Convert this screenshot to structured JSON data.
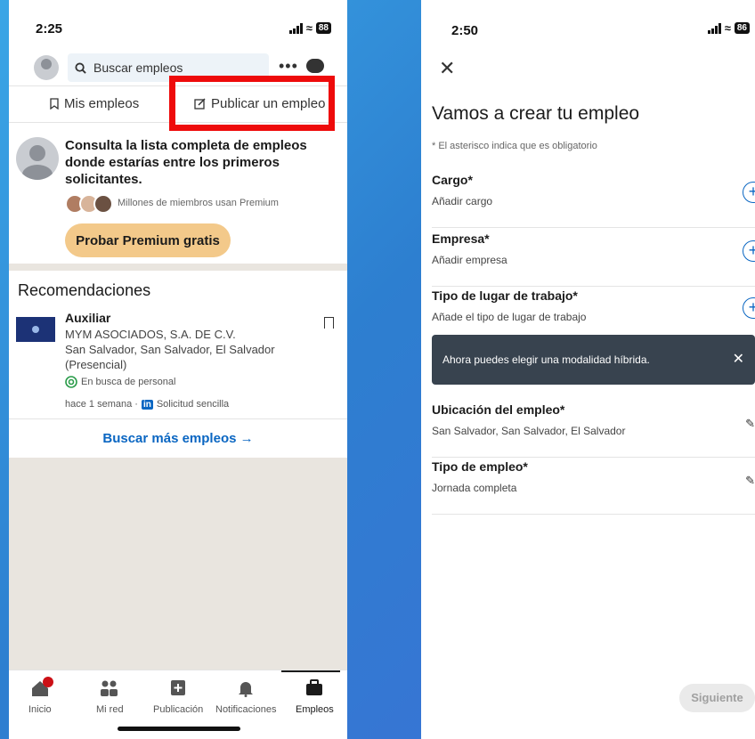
{
  "left": {
    "status": {
      "time": "2:25",
      "battery": "88"
    },
    "search": {
      "placeholder": "Buscar empleos"
    },
    "tabs": {
      "my_jobs": "Mis empleos",
      "post_job": "Publicar un empleo"
    },
    "promo": {
      "text": "Consulta la lista completa de empleos donde estarías entre los primeros solicitantes.",
      "members": "Millones de miembros usan Premium",
      "button": "Probar Premium gratis"
    },
    "recommendations": {
      "title": "Recomendaciones",
      "job": {
        "title": "Auxiliar",
        "company": "MYM ASOCIADOS, S.A. DE C.V.",
        "location": "San Salvador, San Salvador, El Salvador",
        "mode": "(Presencial)",
        "hiring": "En busca de personal",
        "posted": "hace 1 semana ·",
        "apply": "Solicitud sencilla"
      },
      "more_link": "Buscar más empleos →"
    },
    "nav": {
      "home": "Inicio",
      "network": "Mi red",
      "post": "Publicación",
      "notifications": "Notificaciones",
      "jobs": "Empleos"
    },
    "colors": {
      "highlight": "#ee0b0b",
      "premium": "#f3c98a",
      "link": "#0a66c2"
    }
  },
  "right": {
    "status": {
      "time": "2:50",
      "battery": "86"
    },
    "title": "Vamos a crear tu empleo",
    "note": "* El asterisco indica que es obligatorio",
    "fields": [
      {
        "label": "Cargo*",
        "value": "Añadir cargo"
      },
      {
        "label": "Empresa*",
        "value": "Añadir empresa"
      },
      {
        "label": "Tipo de lugar de trabajo*",
        "value": "Añade el tipo de lugar de trabajo"
      },
      {
        "label": "Ubicación del empleo*",
        "value": "San Salvador, San Salvador, El Salvador"
      },
      {
        "label": "Tipo de empleo*",
        "value": "Jornada completa"
      }
    ],
    "toast": "Ahora puedes elegir una modalidad híbrida.",
    "next_button": "Siguiente"
  }
}
